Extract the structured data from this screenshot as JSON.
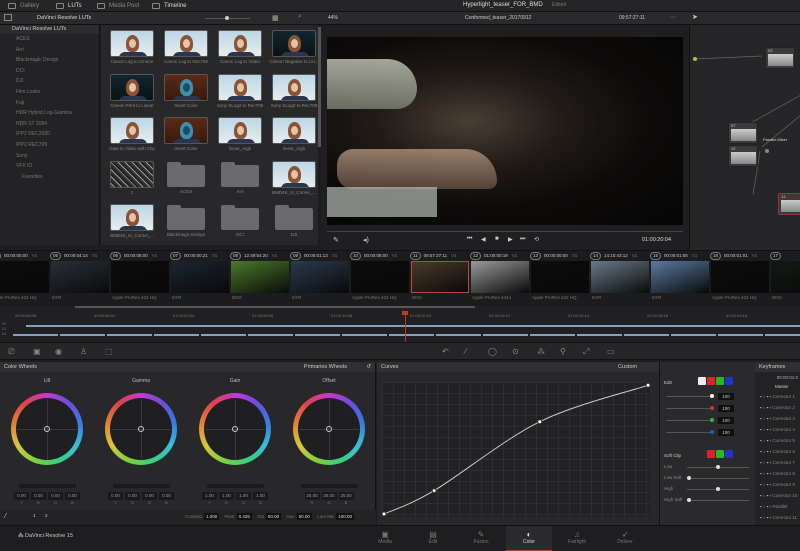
{
  "app": {
    "project_title": "Hyperlight_teaser_FOR_BMD",
    "project_status": "Edited",
    "brand": "DaVinci Resolve 15"
  },
  "top_tabs": [
    {
      "label": "Gallery",
      "icon": "gallery-icon"
    },
    {
      "label": "LUTs",
      "icon": "lut-icon",
      "active": true
    },
    {
      "label": "Media Pool",
      "icon": "media-pool-icon"
    },
    {
      "label": "Timeline",
      "icon": "timeline-icon",
      "active": true
    }
  ],
  "toolbar": {
    "lut_browser_title": "DaVinci Resolve LUTs",
    "zoom": "44%",
    "timeline_name": "Conformed_teaser_20170912",
    "timecode": "09:57:27:11"
  },
  "lut_tree": {
    "root": "DaVinci Resolve LUTs",
    "items": [
      "ACES",
      "Arri",
      "Blackmagic Design",
      "DCI",
      "DJI",
      "Film Looks",
      "Fuji",
      "HDR Hybrid Log-Gamma",
      "HDR ST 2084",
      "IPP2 REC2020",
      "IPP2 REC709",
      "Sony",
      "VFX IO"
    ],
    "favorites": "Favorites"
  },
  "luts": [
    {
      "name": "Canon Log to Cineon",
      "kind": "thumb"
    },
    {
      "name": "Canon Log to Rec709",
      "kind": "thumb"
    },
    {
      "name": "Canon Log to Video",
      "kind": "thumb"
    },
    {
      "name": "Cineon Negative to Lin...",
      "kind": "dark"
    },
    {
      "name": "Cineon Print to Linear",
      "kind": "dark"
    },
    {
      "name": "Invert Color",
      "kind": "inv"
    },
    {
      "name": "Sony SLog2 to Rec709",
      "kind": "thumb"
    },
    {
      "name": "Sony SLog3 to Rec709",
      "kind": "thumb"
    },
    {
      "name": "Data to Video with Clip",
      "kind": "thumb"
    },
    {
      "name": "Invert Color",
      "kind": "inv"
    },
    {
      "name": "linear_srgb",
      "kind": "thumb"
    },
    {
      "name": "linear_srgb",
      "kind": "thumb"
    },
    {
      "name": "1",
      "kind": "noise"
    },
    {
      "name": "ACES",
      "kind": "folder"
    },
    {
      "name": "Arri",
      "kind": "folder"
    },
    {
      "name": "BMD4K_to_Cornel_...",
      "kind": "thumb"
    },
    {
      "name": "BMD4K_to_Cornel_...",
      "kind": "thumb"
    },
    {
      "name": "Blackmagic Design",
      "kind": "folder"
    },
    {
      "name": "DCI",
      "kind": "folder"
    },
    {
      "name": "DJI",
      "kind": "folder"
    }
  ],
  "viewer": {
    "timecode": "01:00:20:04"
  },
  "nodes": [
    {
      "label": "03"
    },
    {
      "label": "07"
    },
    {
      "label": "12"
    },
    {
      "label": "13"
    }
  ],
  "node_mixer_label": "Parallel Mixer",
  "clips": [
    {
      "num": "04",
      "tc": "00:00:00:00",
      "track": "V1",
      "codec": "Apple ProRes 422 HQ",
      "bg": "#0b0b0c"
    },
    {
      "num": "05",
      "tc": "00:00:04:14",
      "track": "V1",
      "codec": "EXR",
      "bg": "#2a3038"
    },
    {
      "num": "06",
      "tc": "00:00:08:00",
      "track": "V1",
      "codec": "Apple ProRes 422 HQ",
      "bg": "#0b0b0c"
    },
    {
      "num": "07",
      "tc": "00:00:00:21",
      "track": "V1",
      "codec": "EXR",
      "bg": "#1d2430"
    },
    {
      "num": "08",
      "tc": "12:49:54:20",
      "track": "V1",
      "codec": "DNG",
      "bg": "#4a7a2a"
    },
    {
      "num": "09",
      "tc": "00:00:01:13",
      "track": "V1",
      "codec": "EXR",
      "bg": "#2a3a50"
    },
    {
      "num": "10",
      "tc": "00:00:08:00",
      "track": "V1",
      "codec": "Apple ProRes 422 HQ",
      "bg": "#0b0b0c"
    },
    {
      "num": "11",
      "tc": "09:57:27:11",
      "track": "V1",
      "codec": "DNG",
      "bg": "#4a3a2a",
      "selected": true
    },
    {
      "num": "12",
      "tc": "01:00:00:19",
      "track": "V1",
      "codec": "Apple ProRes 4444",
      "bg": "#9a9a9a"
    },
    {
      "num": "13",
      "tc": "00:00:00:00",
      "track": "V1",
      "codec": "Apple ProRes 422 HQ",
      "bg": "#0b0b0c"
    },
    {
      "num": "14",
      "tc": "14:10:43:12",
      "track": "V1",
      "codec": "EXR",
      "bg": "#6a7a8a"
    },
    {
      "num": "15",
      "tc": "00:00:01:05",
      "track": "V1",
      "codec": "EXR",
      "bg": "#5a7aa0"
    },
    {
      "num": "16",
      "tc": "00:00:01:01",
      "track": "V1",
      "codec": "Apple ProRes 422 HQ",
      "bg": "#0b0b0c"
    },
    {
      "num": "17",
      "tc": "",
      "track": "",
      "codec": "DNG",
      "bg": "#121a14"
    }
  ],
  "ruler": [
    "00:59:58:08",
    "00:59:56:02",
    "01:00:02:04",
    "01:00:08:06",
    "01:00:14:08",
    "01:00:20:10",
    "01:00:26:12",
    "01:00:32:14",
    "01:00:38:16",
    "01:00:44:18"
  ],
  "track_labels": [
    "V2",
    "V1",
    "A1"
  ],
  "color_wheels": {
    "title": "Color Wheels",
    "mode": "Primaries Wheels",
    "wheels": [
      {
        "name": "Lift",
        "values": [
          "0.00",
          "0.00",
          "0.00",
          "0.00"
        ],
        "channels": [
          "Y",
          "R",
          "G",
          "B"
        ]
      },
      {
        "name": "Gamma",
        "values": [
          "0.00",
          "0.00",
          "0.00",
          "0.00"
        ],
        "channels": [
          "Y",
          "R",
          "G",
          "B"
        ]
      },
      {
        "name": "Gain",
        "values": [
          "1.00",
          "1.00",
          "1.00",
          "1.00"
        ],
        "channels": [
          "Y",
          "R",
          "G",
          "B"
        ]
      },
      {
        "name": "Offset",
        "values": [
          "25.00",
          "25.00",
          "25.00"
        ],
        "channels": [
          "R",
          "G",
          "B"
        ]
      }
    ],
    "footer": {
      "contrast_label": "Contrast",
      "contrast": "1.000",
      "pivot_label": "Pivot",
      "pivot": "0.435",
      "sat_label": "Sat",
      "sat": "50.00",
      "hue_label": "Hue",
      "hue": "50.00",
      "lum_mix_label": "Lum Mix",
      "lum_mix": "100.00",
      "page_1": "1",
      "page_2": "2"
    }
  },
  "curves": {
    "title": "Curves",
    "mode": "Custom",
    "points": [
      [
        0,
        0
      ],
      [
        19,
        18
      ],
      [
        59,
        71
      ],
      [
        100,
        99
      ]
    ]
  },
  "edit_panel": {
    "edit_label": "Edit",
    "values": [
      "100",
      "100",
      "100",
      "100"
    ],
    "soft_clip_label": "Soft Clip",
    "soft_clip": [
      "Low",
      "Low Soft",
      "High",
      "High Soft"
    ],
    "soft_clip_levels": [
      0.5,
      0,
      0.5,
      0
    ]
  },
  "keyframes": {
    "title": "Keyframes",
    "timecode": "00:00:01:0",
    "master": "Master",
    "rows": [
      "Corrector 1",
      "Corrector 2",
      "Corrector 3",
      "Corrector 4",
      "Corrector 5",
      "Corrector 6",
      "Corrector 7",
      "Corrector 8",
      "Corrector 9",
      "Corrector 10",
      "Parallel",
      "Corrector 11",
      "Corrector 12",
      "Sizing"
    ]
  },
  "pages": [
    {
      "label": "Media",
      "icon": "▣"
    },
    {
      "label": "Edit",
      "icon": "▤"
    },
    {
      "label": "Fusion",
      "icon": "✎"
    },
    {
      "label": "Color",
      "icon": "◐",
      "active": true
    },
    {
      "label": "Fairlight",
      "icon": "♫"
    },
    {
      "label": "Deliver",
      "icon": "➶"
    }
  ],
  "colors": {
    "accent_red": "#c0392b",
    "selected_clip": "#b34a3c",
    "node_input": "#a8c832",
    "node_output": "#3aa0c8"
  }
}
